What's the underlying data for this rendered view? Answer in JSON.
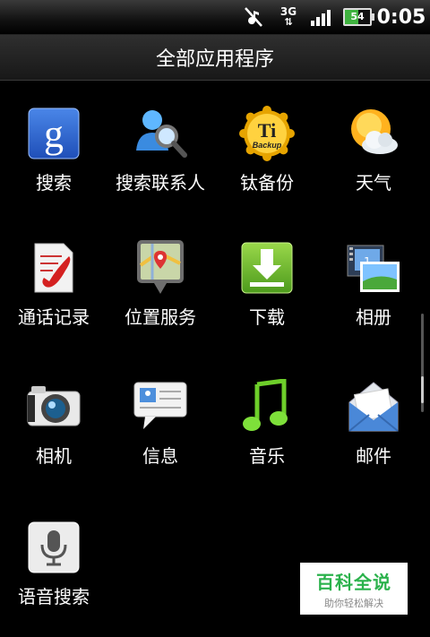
{
  "status_bar": {
    "time": "0:05",
    "network": "3G",
    "battery_level": "54",
    "icons": [
      "mute-icon",
      "data-3g-icon",
      "signal-icon",
      "battery-icon"
    ]
  },
  "header": {
    "title": "全部应用程序"
  },
  "apps": [
    {
      "label": "搜索",
      "icon": "google-search-icon"
    },
    {
      "label": "搜索联系人",
      "icon": "contact-search-icon"
    },
    {
      "label": "钛备份",
      "icon": "titanium-backup-icon"
    },
    {
      "label": "天气",
      "icon": "weather-icon"
    },
    {
      "label": "通话记录",
      "icon": "call-log-icon"
    },
    {
      "label": "位置服务",
      "icon": "map-location-icon"
    },
    {
      "label": "下载",
      "icon": "download-icon"
    },
    {
      "label": "相册",
      "icon": "gallery-icon"
    },
    {
      "label": "相机",
      "icon": "camera-icon"
    },
    {
      "label": "信息",
      "icon": "messages-icon"
    },
    {
      "label": "音乐",
      "icon": "music-icon"
    },
    {
      "label": "邮件",
      "icon": "mail-icon"
    },
    {
      "label": "语音搜索",
      "icon": "voice-search-icon"
    }
  ],
  "watermark": {
    "title": "百科全说",
    "subtitle": "助你轻松解决"
  }
}
